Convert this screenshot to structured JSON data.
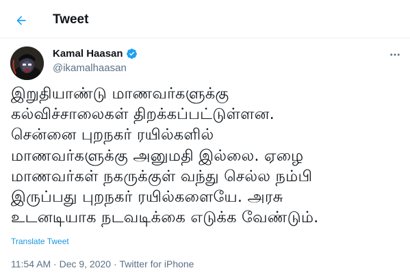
{
  "header": {
    "title": "Tweet",
    "back_icon": "arrow-left-icon",
    "accent_color": "#1da1f2"
  },
  "author": {
    "name": "Kamal Haasan",
    "handle": "@ikamalhaasan",
    "verified": true,
    "verified_icon": "verified-badge-icon"
  },
  "more_icon": "more-options-icon",
  "tweet": {
    "text": "இறுதியாண்டு மாணவர்களுக்கு\nகல்விச்சாலைகள் திறக்கப்பட்டுள்ளன.\nசென்னை புறநகர் ரயில்களில்\nமாணவர்களுக்கு அனுமதி இல்லை. ஏழை\nமாணவர்கள் நகருக்குள் வந்து செல்ல நம்பி\nஇருப்பது புறநகர் ரயில்களையே. அரசு\nஉடனடியாக நடவடிக்கை எடுக்க வேண்டும்.",
    "translate_label": "Translate Tweet"
  },
  "meta": {
    "time": "11:54 AM",
    "separator": " · ",
    "date": "Dec 9, 2020",
    "separator2": " · ",
    "source": "Twitter for iPhone"
  }
}
